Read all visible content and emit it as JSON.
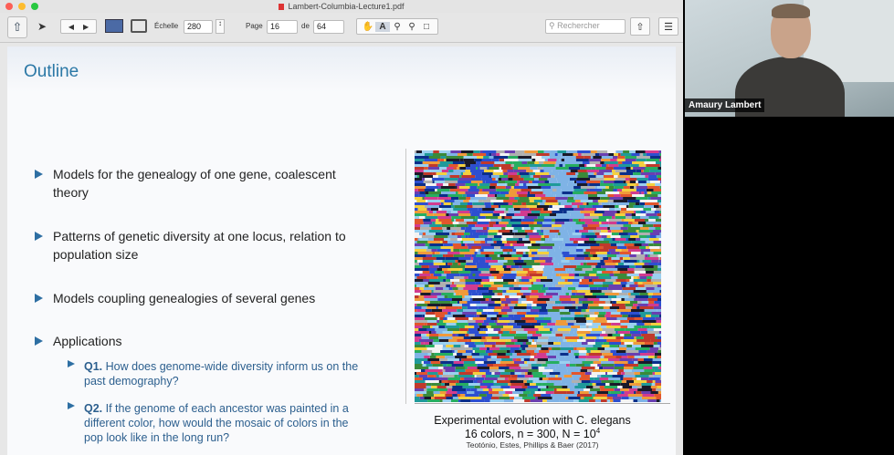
{
  "window": {
    "title": "Lambert-Columbia-Lecture1.pdf"
  },
  "toolbar": {
    "scale_label": "Échelle",
    "scale_value": "280",
    "page_label": "Page",
    "page_value": "16",
    "of_label": "de",
    "total_pages": "64",
    "search_placeholder": "Rechercher"
  },
  "slide": {
    "title": "Outline",
    "bullets": [
      {
        "line1": "Models for the genealogy of one gene, coalescent",
        "line2": "theory"
      },
      {
        "line1": "Patterns of genetic diversity at one locus, relation to",
        "line2": "population size"
      },
      {
        "line1": "Models coupling genealogies of several genes",
        "line2": ""
      },
      {
        "line1": "Applications",
        "line2": ""
      }
    ],
    "questions": [
      {
        "label": "Q1.",
        "line1": "How does genome-wide diversity inform us on the",
        "line2": "past demography?",
        "line3": ""
      },
      {
        "label": "Q2.",
        "line1": "If the genome of each ancestor was painted in a",
        "line2": "different color, how would the mosaic of colors in the",
        "line3": "pop look like in the long run?"
      }
    ],
    "figure_caption": {
      "line1": "Experimental evolution with C. elegans",
      "line2": "16 colors, n = 300, N = 10",
      "line2_sup": "4",
      "line3": "Teotónio, Estes, Phillips & Baer (2017)"
    }
  },
  "video": {
    "participant_name": "Amaury Lambert"
  },
  "colors": {
    "accent": "#2b78a6",
    "bullet": "#2e6fa3",
    "mosaic": [
      "#2d4fd0",
      "#e2562d",
      "#f3f3f3",
      "#1a1a2a",
      "#7fb3e6",
      "#f09a3a",
      "#3a8a3a",
      "#d23b8f",
      "#9ad0f0",
      "#f4d03f",
      "#6a3fb0",
      "#1f9a9a",
      "#c0392b",
      "#27ae60",
      "#b0b0b0",
      "#0b2f8a"
    ]
  }
}
